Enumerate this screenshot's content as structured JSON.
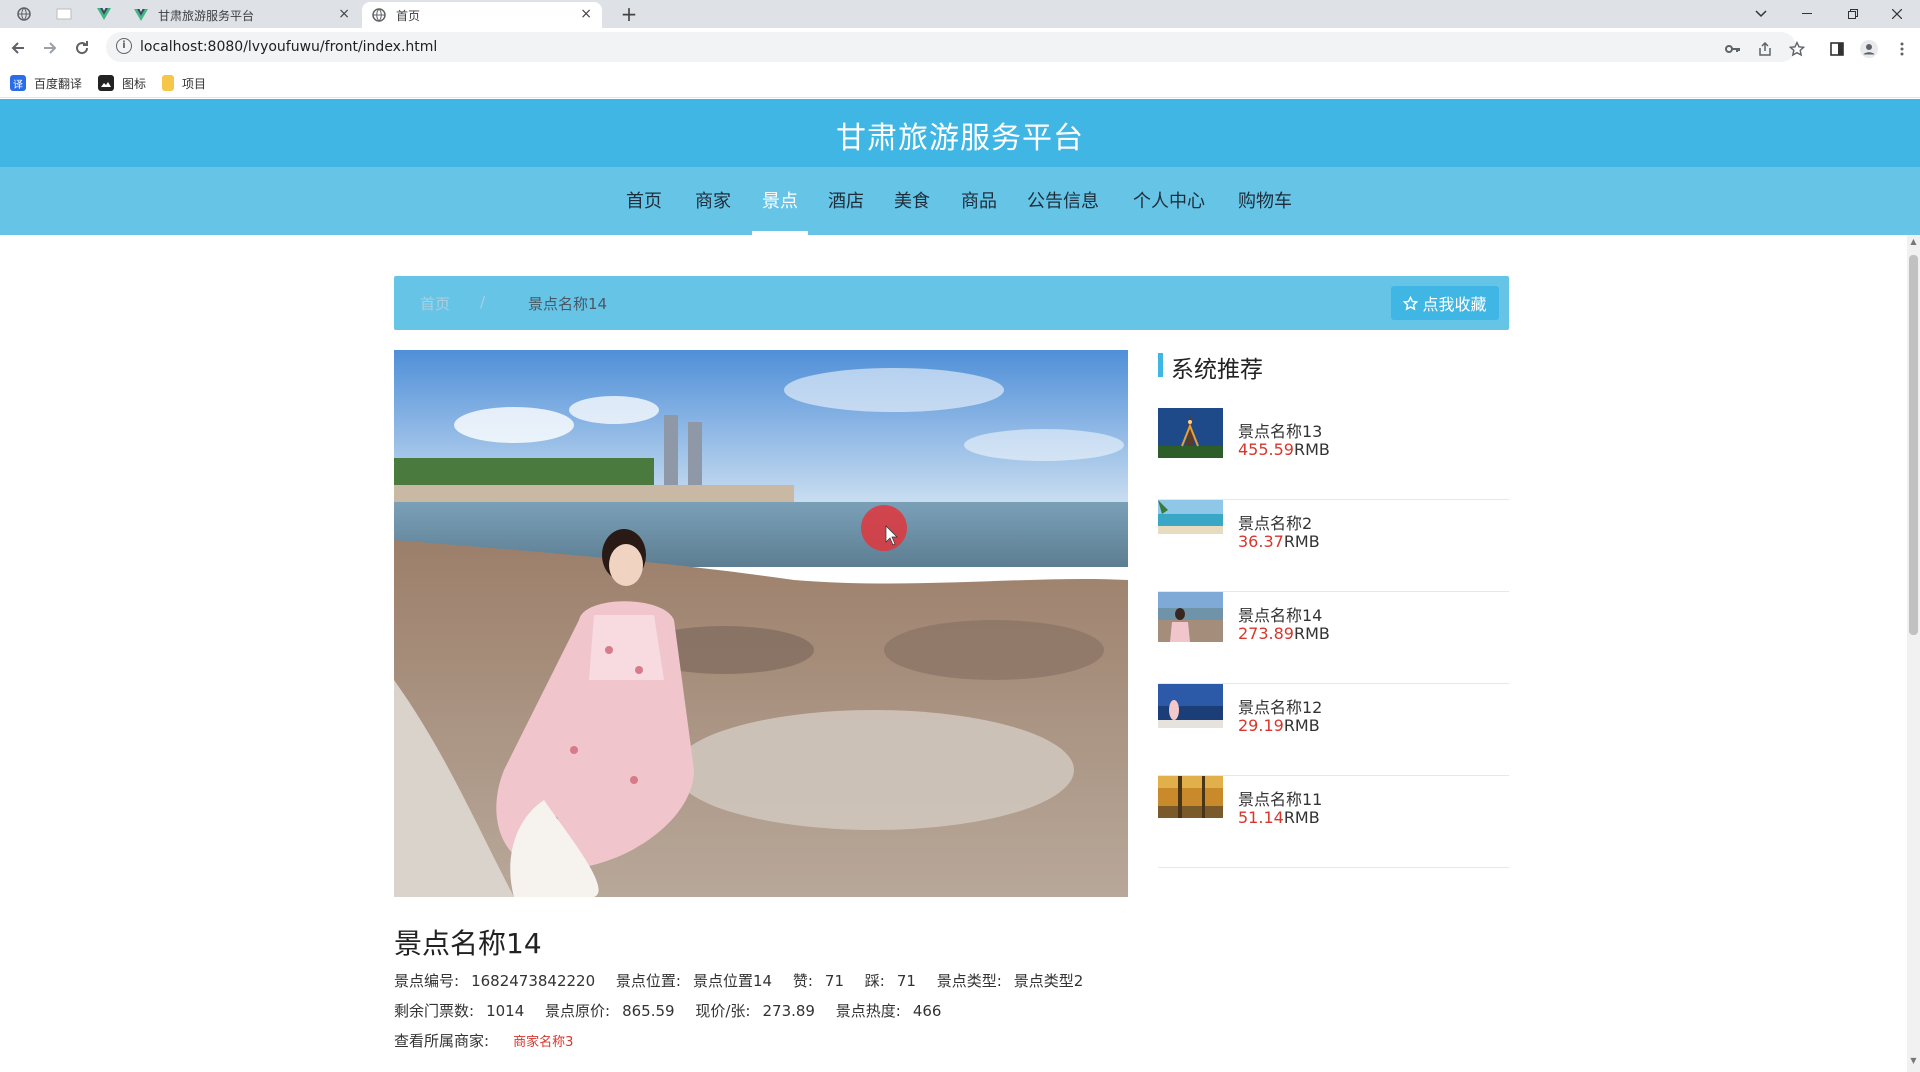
{
  "browser": {
    "tabs": [
      {
        "title": "甘肃旅游服务平台",
        "close": "×"
      },
      {
        "title": "首页",
        "close": "×"
      }
    ],
    "new_tab": "+",
    "url": "localhost:8080/lvyoufuwu/front/index.html",
    "bookmarks": [
      {
        "label": "百度翻译",
        "icon_text": "译",
        "color": "#2b6de8"
      },
      {
        "label": "图标",
        "icon_text": "",
        "color": "#222222"
      },
      {
        "label": "项目",
        "icon_text": "",
        "color": "#f5c64a"
      }
    ]
  },
  "site": {
    "title": "甘肃旅游服务平台",
    "nav": [
      "首页",
      "商家",
      "景点",
      "酒店",
      "美食",
      "商品",
      "公告信息",
      "个人中心",
      "购物车"
    ],
    "active_nav": "景点",
    "colors": {
      "header": "#3fb6e4",
      "nav": "#66c4e6",
      "accent": "#3fb6e4",
      "price": "#d8362c"
    }
  },
  "breadcrumb": {
    "home": "首页",
    "separator": "/",
    "current": "景点名称14",
    "favorite_button": "点我收藏"
  },
  "detail": {
    "name": "景点名称14",
    "line1": [
      {
        "label": "景点编号:",
        "value": "1682473842220"
      },
      {
        "label": "景点位置:",
        "value": "景点位置14"
      },
      {
        "label": "赞:",
        "value": "71"
      },
      {
        "label": "踩:",
        "value": "71"
      },
      {
        "label": "景点类型:",
        "value": "景点类型2"
      }
    ],
    "line2": [
      {
        "label": "剩余门票数:",
        "value": "1014"
      },
      {
        "label": "景点原价:",
        "value": "865.59"
      },
      {
        "label": "现价/张:",
        "value": "273.89"
      },
      {
        "label": "景点热度:",
        "value": "466"
      }
    ],
    "merchant_label": "查看所属商家:",
    "merchant_link": "商家名称3"
  },
  "recommend": {
    "title": "系统推荐",
    "unit": "RMB",
    "items": [
      {
        "name": "景点名称13",
        "price": "455.59",
        "thumb": "eiffel"
      },
      {
        "name": "景点名称2",
        "price": "36.37",
        "thumb": "beach"
      },
      {
        "name": "景点名称14",
        "price": "273.89",
        "thumb": "girl-sea"
      },
      {
        "name": "景点名称12",
        "price": "29.19",
        "thumb": "sea-sky"
      },
      {
        "name": "景点名称11",
        "price": "51.14",
        "thumb": "autumn"
      }
    ]
  }
}
